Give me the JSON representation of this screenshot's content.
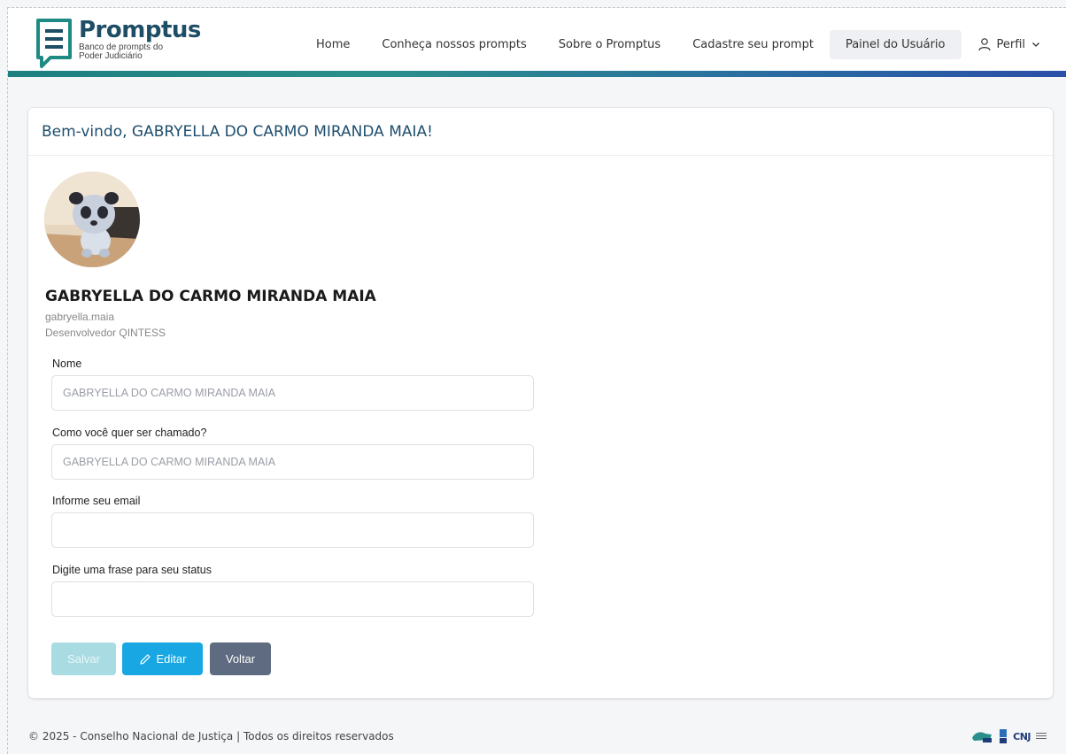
{
  "brand": {
    "title": "Promptus",
    "subtitle_line1": "Banco de prompts do",
    "subtitle_line2": "Poder Judiciário",
    "logo_icon": "document-lines-icon",
    "color": "#1e4e66"
  },
  "nav": {
    "items": [
      {
        "label": "Home",
        "active": false
      },
      {
        "label": "Conheça nossos prompts",
        "active": false
      },
      {
        "label": "Sobre o Promptus",
        "active": false
      },
      {
        "label": "Cadastre seu prompt",
        "active": false
      },
      {
        "label": "Painel do Usuário",
        "active": true
      }
    ],
    "profile_label": "Perfil",
    "profile_icon": "user-icon",
    "dropdown_icon": "chevron-down-icon"
  },
  "colors": {
    "accent_gradient_start": "#1e7f80",
    "accent_gradient_end": "#2b4fa8",
    "title": "#1e4e6e",
    "edit_button": "#18a7e3",
    "back_button": "#5e6b80",
    "save_button_disabled": "#a8dbe2"
  },
  "card": {
    "title": "Bem-vindo, GABRYELLA DO CARMO MIRANDA MAIA!"
  },
  "user": {
    "name": "GABRYELLA DO CARMO MIRANDA MAIA",
    "login": "gabryella.maia",
    "role": "Desenvolvedor QINTESS",
    "avatar_icon": "panda-avatar"
  },
  "form": {
    "nome": {
      "label": "Nome",
      "value": "",
      "placeholder": "GABRYELLA DO CARMO MIRANDA MAIA"
    },
    "apelido": {
      "label": "Como você quer ser chamado?",
      "value": "",
      "placeholder": "GABRYELLA DO CARMO MIRANDA MAIA"
    },
    "email": {
      "label": "Informe seu email",
      "value": "",
      "placeholder": ""
    },
    "status": {
      "label": "Digite uma frase para seu status",
      "value": "",
      "placeholder": ""
    }
  },
  "buttons": {
    "save": "Salvar",
    "edit": "Editar",
    "edit_icon": "pencil-icon",
    "back": "Voltar"
  },
  "footer": {
    "text": "© 2025 - Conselho Nacional de Justiça | Todos os direitos reservados",
    "logos": [
      "justica-logo",
      "bar-logo",
      "cnj-logo"
    ],
    "cnj_label": "CNJ"
  }
}
